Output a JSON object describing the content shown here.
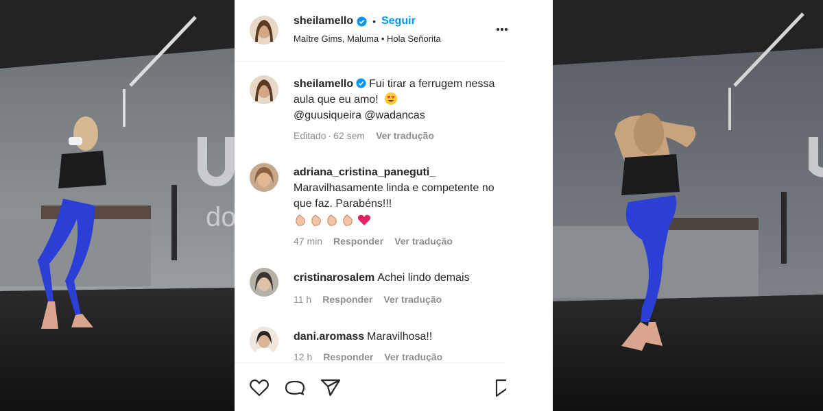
{
  "post": {
    "author": {
      "username": "sheilamello",
      "verified": true,
      "follow_label": "Seguir",
      "separator": "•",
      "audio": "Maître Gims, Maluma • Hola Señorita"
    },
    "caption": {
      "username": "sheilamello",
      "text": "Fui tirar a ferrugem nessa aula que eu amo!",
      "emoji": "heart-eyes-emoji",
      "mentions": "@guusiqueira @wadancas",
      "edited_label": "Editado",
      "meta_separator": "·",
      "time": "62 sem",
      "translate_label": "Ver tradução"
    },
    "comments": [
      {
        "username": "adriana_cristina_paneguti_",
        "text": "Maravilhasamente linda e competente no que faz. Parabéns!!!",
        "emoji": [
          "clap-emoji",
          "clap-emoji",
          "clap-emoji",
          "clap-emoji",
          "heart-emoji"
        ],
        "time": "47 min",
        "reply_label": "Responder",
        "translate_label": "Ver tradução"
      },
      {
        "username": "cristinarosalem",
        "text": "Achei lindo demais",
        "time": "11 h",
        "reply_label": "Responder",
        "translate_label": "Ver tradução"
      },
      {
        "username": "dani.aromass",
        "text": "Maravilhosa!!",
        "time": "12 h",
        "reply_label": "Responder",
        "translate_label": "Ver tradução"
      }
    ]
  },
  "actions": {
    "like": "heart-outline-icon",
    "comment": "speech-bubble-icon",
    "share": "paper-plane-icon",
    "save": "bookmark-icon"
  },
  "colors": {
    "link_blue": "#0095f6",
    "verified_blue": "#0095f6",
    "muted": "#8e8e8e",
    "text": "#262626"
  }
}
